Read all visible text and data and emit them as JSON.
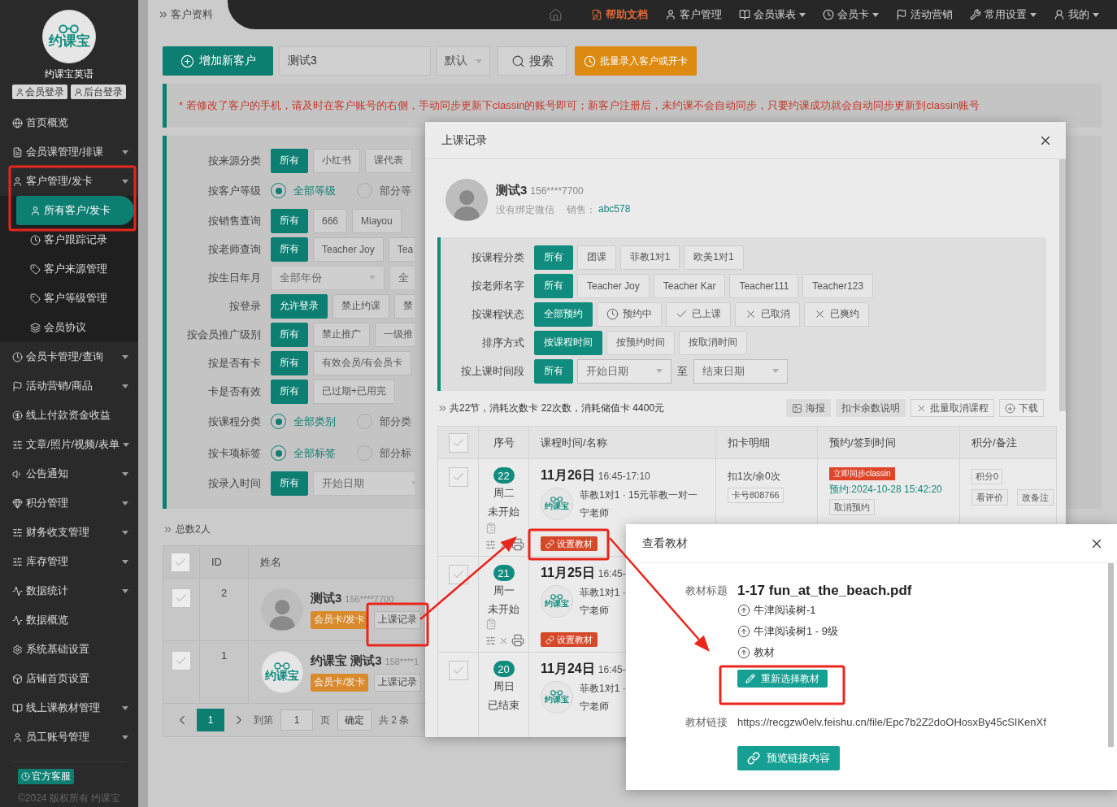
{
  "sidebar": {
    "logo_text": "约课宝",
    "brand": "约课宝英语",
    "login_buttons": [
      "会员登录",
      "后台登录"
    ],
    "items": [
      {
        "label": "首页概览",
        "expandable": false,
        "selected": false
      },
      {
        "label": "会员课管理/排课",
        "expandable": true,
        "selected": false
      },
      {
        "label": "客户管理/发卡",
        "expandable": true,
        "expanded": true,
        "selected": false,
        "children": [
          {
            "label": "所有客户/发卡",
            "selected": true
          },
          {
            "label": "客户跟踪记录",
            "selected": false
          },
          {
            "label": "客户来源管理",
            "selected": false
          },
          {
            "label": "客户等级管理",
            "selected": false
          },
          {
            "label": "会员协议",
            "selected": false
          }
        ]
      },
      {
        "label": "会员卡管理/查询",
        "expandable": true,
        "selected": false
      },
      {
        "label": "活动营销/商品",
        "expandable": true,
        "selected": false
      },
      {
        "label": "线上付款资金收益",
        "expandable": false,
        "selected": false
      },
      {
        "label": "文章/照片/视频/表单",
        "expandable": true,
        "selected": false
      },
      {
        "label": "公告通知",
        "expandable": true,
        "selected": false
      },
      {
        "label": "积分管理",
        "expandable": true,
        "selected": false
      },
      {
        "label": "财务收支管理",
        "expandable": true,
        "selected": false
      },
      {
        "label": "库存管理",
        "expandable": true,
        "selected": false
      },
      {
        "label": "数据统计",
        "expandable": true,
        "selected": false
      },
      {
        "label": "数据概览",
        "expandable": false,
        "selected": false
      },
      {
        "label": "系统基础设置",
        "expandable": false,
        "selected": false
      },
      {
        "label": "店铺首页设置",
        "expandable": false,
        "selected": false
      },
      {
        "label": "线上课教材管理",
        "expandable": true,
        "selected": false
      },
      {
        "label": "员工账号管理",
        "expandable": true,
        "selected": false
      }
    ],
    "support_badge": "官方客服",
    "copyright": "©2024 版权所有 约课宝"
  },
  "topbar": {
    "breadcrumb": "客户资料",
    "nav": [
      {
        "kind": "home"
      },
      {
        "kind": "help",
        "label": "帮助文档",
        "dropdown": false
      },
      {
        "kind": "user",
        "label": "客户管理",
        "dropdown": false
      },
      {
        "kind": "book",
        "label": "会员课表",
        "dropdown": true
      },
      {
        "kind": "clock",
        "label": "会员卡",
        "dropdown": true
      },
      {
        "kind": "flag",
        "label": "活动营销",
        "dropdown": false
      },
      {
        "kind": "settings",
        "label": "常用设置",
        "dropdown": true
      },
      {
        "kind": "person",
        "label": "我的",
        "dropdown": true
      }
    ]
  },
  "toolbar": {
    "add_button": "增加新客户",
    "search_value": "测试3",
    "sort_select": "默认",
    "search_button": "搜索",
    "batch_button": "批量录入客户或开卡"
  },
  "notice": "* 若修改了客户的手机，请及时在客户账号的右侧，手动同步更新下classin的账号即可；新客户注册后，未约课不会自动同步，只要约课成功就会自动同步更新到classin账号",
  "filters": [
    {
      "label": "按来源分类",
      "options": [
        {
          "kind": "button",
          "label": "所有",
          "selected": true
        },
        {
          "kind": "button",
          "label": "小红书",
          "selected": false
        },
        {
          "kind": "button",
          "label": "课代表",
          "selected": false
        }
      ]
    },
    {
      "label": "按客户等级",
      "options": [
        {
          "kind": "radio",
          "label": "全部等级",
          "selected": true
        },
        {
          "kind": "radio",
          "label": "部分等",
          "selected": false
        }
      ]
    },
    {
      "label": "按销售查询",
      "options": [
        {
          "kind": "button",
          "label": "所有",
          "selected": true
        },
        {
          "kind": "button",
          "label": "666",
          "selected": false
        },
        {
          "kind": "button",
          "label": "Miayou",
          "selected": false
        }
      ]
    },
    {
      "label": "按老师查询",
      "options": [
        {
          "kind": "button",
          "label": "所有",
          "selected": true
        },
        {
          "kind": "button",
          "label": "Teacher Joy",
          "selected": false
        },
        {
          "kind": "button",
          "label": "Tea",
          "selected": false
        }
      ]
    },
    {
      "label": "按生日年月",
      "options": [
        {
          "kind": "select",
          "label": "全部年份",
          "selected": false
        },
        {
          "kind": "select",
          "label": "全",
          "selected": false
        }
      ]
    },
    {
      "label": "按登录",
      "options": [
        {
          "kind": "button",
          "label": "允许登录",
          "selected": true
        },
        {
          "kind": "button",
          "label": "禁止约课",
          "selected": false
        },
        {
          "kind": "button",
          "label": "禁",
          "selected": false
        }
      ]
    },
    {
      "label": "按会员推广级别",
      "options": [
        {
          "kind": "button",
          "label": "所有",
          "selected": true
        },
        {
          "kind": "button",
          "label": "禁止推广",
          "selected": false
        },
        {
          "kind": "button",
          "label": "一级推",
          "selected": false
        }
      ]
    },
    {
      "label": "按是否有卡",
      "options": [
        {
          "kind": "button",
          "label": "所有",
          "selected": true
        },
        {
          "kind": "button",
          "label": "有效会员/有会员卡",
          "selected": false
        }
      ]
    },
    {
      "label": "卡是否有效",
      "options": [
        {
          "kind": "button",
          "label": "所有",
          "selected": true
        },
        {
          "kind": "button",
          "label": "已过期+已用完",
          "selected": false
        }
      ]
    },
    {
      "label": "按课程分类",
      "options": [
        {
          "kind": "radio",
          "label": "全部类别",
          "selected": true
        },
        {
          "kind": "radio",
          "label": "部分类",
          "selected": false
        }
      ]
    },
    {
      "label": "按卡项标签",
      "options": [
        {
          "kind": "radio",
          "label": "全部标签",
          "selected": true
        },
        {
          "kind": "radio",
          "label": "部分标",
          "selected": false
        }
      ]
    },
    {
      "label": "按录入时间",
      "options": [
        {
          "kind": "button",
          "label": "所有",
          "selected": true
        },
        {
          "kind": "select",
          "label": "开始日期",
          "selected": false
        }
      ]
    }
  ],
  "total": "总数2人",
  "customers": {
    "columns": [
      "ID",
      "姓名"
    ],
    "select_all_checked": false,
    "rows": [
      {
        "checked": false,
        "id": "2",
        "kind": "person",
        "name": "测试3",
        "phone": "156****7700",
        "card_button": "会员卡/发卡",
        "records_button": "上课记录"
      },
      {
        "checked": false,
        "id": "1",
        "kind": "logo",
        "logo_text": "约课宝",
        "name": "约课宝 测试3",
        "phone": "158****1",
        "card_button": "会员卡/发卡",
        "records_button": "上课记录"
      }
    ]
  },
  "pagination": {
    "pages": [
      {
        "label": "1",
        "selected": true
      }
    ],
    "goto_label": "到第",
    "goto_value": "1",
    "page_unit": "页",
    "confirm": "确定",
    "total": "共 2 条"
  },
  "records_dialog": {
    "title": "上课记录",
    "customer": {
      "name": "测试3",
      "phone": "156****7700",
      "wechat": "没有绑定微信",
      "sales_label": "销售：",
      "sales": "abc578"
    },
    "filters": [
      {
        "label": "按课程分类",
        "options": [
          {
            "kind": "button",
            "label": "所有",
            "selected": true
          },
          {
            "kind": "button",
            "label": "团课",
            "selected": false
          },
          {
            "kind": "button",
            "label": "菲教1对1",
            "selected": false
          },
          {
            "kind": "button",
            "label": "欧美1对1",
            "selected": false
          }
        ]
      },
      {
        "label": "按老师名字",
        "options": [
          {
            "kind": "button",
            "label": "所有",
            "selected": true
          },
          {
            "kind": "button",
            "label": "Teacher Joy",
            "selected": false
          },
          {
            "kind": "button",
            "label": "Teacher Kar",
            "selected": false
          },
          {
            "kind": "button",
            "label": "Teacher111",
            "selected": false
          },
          {
            "kind": "button",
            "label": "Teacher123",
            "selected": false
          }
        ]
      },
      {
        "label": "按课程状态",
        "options": [
          {
            "kind": "button",
            "label": "全部预约",
            "selected": true
          },
          {
            "kind": "clock-button",
            "label": "预约中",
            "selected": false
          },
          {
            "kind": "check-button",
            "label": "已上课",
            "selected": false
          },
          {
            "kind": "cross-button",
            "label": "已取消",
            "selected": false
          },
          {
            "kind": "cross-button",
            "label": "已爽约",
            "selected": false
          }
        ]
      },
      {
        "label": "排序方式",
        "options": [
          {
            "kind": "button",
            "label": "按课程时间",
            "selected": true
          },
          {
            "kind": "button",
            "label": "按预约时间",
            "selected": false
          },
          {
            "kind": "button",
            "label": "按取消时间",
            "selected": false
          }
        ]
      },
      {
        "label": "按上课时间段",
        "options": [
          {
            "kind": "button",
            "label": "所有",
            "selected": true
          },
          {
            "kind": "select",
            "label": "开始日期",
            "selected": false
          },
          {
            "kind": "text",
            "label": "至"
          },
          {
            "kind": "select",
            "label": "结束日期",
            "selected": false
          }
        ]
      }
    ],
    "summary": "共22节，消耗次数卡 22次数，消耗储值卡 4400元",
    "actions": [
      {
        "kind": "poster",
        "label": "海报"
      },
      {
        "kind": "plain",
        "label": "扣卡余数说明"
      },
      {
        "kind": "cancel",
        "label": "批量取消课程"
      },
      {
        "kind": "download",
        "label": "下载"
      }
    ],
    "columns": [
      "序号",
      "课程时间/名称",
      "扣卡明细",
      "预约/签到时间",
      "积分/备注"
    ],
    "select_all_checked": false,
    "rows": [
      {
        "checked": false,
        "number": "22",
        "weekday": "周二",
        "status": "未开始",
        "date": "11月26日",
        "time": "16:45-17:10",
        "logo_text": "约课宝",
        "course": "菲教1对1 · 15元菲教一对一",
        "teacher": "宁老师",
        "material_button": "设置教材",
        "deduction": "扣1次/余0次",
        "card_no": "卡号808766",
        "sync_badge": "立即同步classin",
        "booked": "预约:2024-10-28 15:42:20",
        "cancel_button": "取消预约",
        "points": "积分0",
        "review_button": "看评价",
        "note_button": "改备注"
      },
      {
        "checked": false,
        "number": "21",
        "weekday": "周一",
        "status": "未开始",
        "date": "11月25日",
        "time": "16:45-",
        "logo_text": "约课宝",
        "course": "菲教1对1 ·",
        "teacher": "宁老师",
        "material_button": "设置教材"
      },
      {
        "checked": false,
        "number": "20",
        "weekday": "周日",
        "status": "已结束",
        "date": "11月24日",
        "time": "16:45-",
        "logo_text": "约课宝",
        "course": "菲教1对1 ·",
        "teacher": "宁老师"
      }
    ]
  },
  "material_dialog": {
    "title": "查看教材",
    "title_label": "教材标题",
    "file_name": "1-17 fun_at_the_beach.pdf",
    "path": [
      "牛津阅读树-1",
      "牛津阅读树1 - 9级",
      "教材"
    ],
    "reselect_button": "重新选择教材",
    "link_label": "教材链接",
    "link": "https://recgzw0elv.feishu.cn/file/Epc7b2Z2doOHosxBy45cSIKenXf",
    "preview_button": "预览链接内容"
  }
}
